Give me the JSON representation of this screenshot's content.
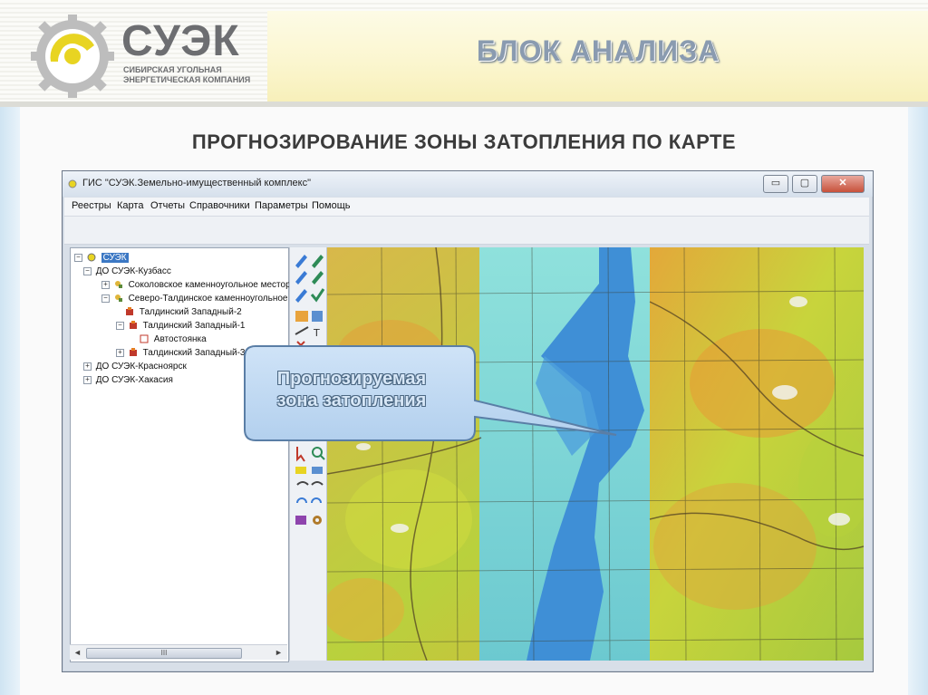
{
  "brand": {
    "name": "СУЭК",
    "subtitle_line1": "СИБИРСКАЯ УГОЛЬНАЯ",
    "subtitle_line2": "ЭНЕРГЕТИЧЕСКАЯ КОМПАНИЯ"
  },
  "slide": {
    "section_title": "БЛОК АНАЛИЗА",
    "subtitle": "ПРОГНОЗИРОВАНИЕ ЗОНЫ ЗАТОПЛЕНИЯ ПО КАРТЕ"
  },
  "window": {
    "title": "ГИС \"СУЭК.Земельно-имущественный комплекс\"",
    "minimize_label": "▭",
    "restore_label": "▢",
    "close_label": "✕"
  },
  "menu": {
    "items": [
      "Реестры",
      "Карта",
      "Отчеты",
      "Справочники",
      "Параметры",
      "Помощь"
    ]
  },
  "tree": {
    "root": "СУЭК",
    "kuzbass": "ДО СУЭК-Кузбасс",
    "sokolovskoe": "Соколовское каменноугольное месторож",
    "severo": "Северо-Талдинское каменноугольное мес",
    "zapadny2": "Талдинский Западный-2",
    "zapadny1": "Талдинский Западный-1",
    "avtostoyanka": "Автостоянка",
    "zapadny3": "Талдинский Западный-3",
    "krasnoyarsk": "ДО СУЭК-Красноярск",
    "khakasia": "ДО СУЭК-Хакасия"
  },
  "scrollbar": {
    "thumb_grip": "III",
    "left_arrow": "◄",
    "right_arrow": "►"
  },
  "callout": {
    "line1": "Прогнозируемая",
    "line2": "зона затопления"
  },
  "colors": {
    "accent_yellow": "#e6d43a",
    "flood_blue": "#3f8fd6",
    "flood_cyan": "#7fd8d8",
    "terrain_green": "#9cc53b",
    "terrain_orange": "#e2a23c"
  }
}
